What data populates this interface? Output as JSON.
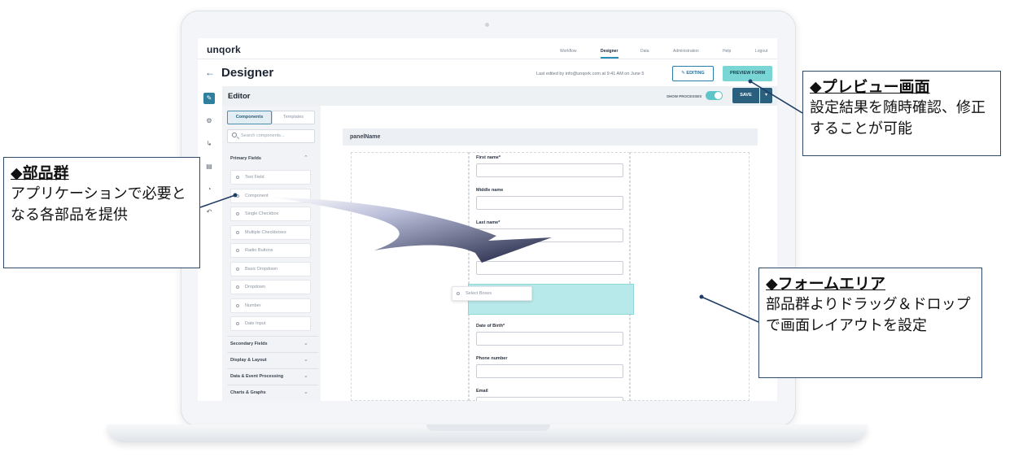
{
  "app": {
    "logo": "unqork",
    "nav": [
      "Workflow",
      "Designer",
      "Data",
      "Administration",
      "Help",
      "Logout"
    ],
    "active_nav": "Designer"
  },
  "header": {
    "back_icon": "arrow-left-icon",
    "title": "Designer",
    "last_edited": "Last edited by info@unqork.com at 9:41 AM on June 5",
    "editing_label": "EDITING",
    "preview_label": "PREVIEW FORM"
  },
  "editor": {
    "title": "Editor",
    "show_processes_label": "SHOW PROCESSES",
    "save_label": "SAVE",
    "caret": "▾"
  },
  "rail": {
    "icons": [
      "pencil-icon",
      "gear-icon",
      "workflow-icon",
      "clipboard-icon",
      "palette-icon",
      "hierarchy-icon"
    ]
  },
  "components": {
    "tab_components": "Components",
    "tab_templates": "Templates",
    "search_placeholder": "Search components...",
    "primary_header": "Primary Fields",
    "primary_items": [
      "Text Field",
      "Component",
      "Single Checkbox",
      "Multiple Checkboxes",
      "Radio Buttons",
      "Basic Dropdown",
      "Dropdown",
      "Number",
      "Date Input"
    ],
    "sections": [
      "Secondary Fields",
      "Display & Layout",
      "Data & Event Processing",
      "Charts & Graphs"
    ]
  },
  "canvas": {
    "panel_name": "panelName",
    "fields": [
      "First name*",
      "Middle name",
      "Last name*",
      "Date of Birth*",
      "Phone number",
      "Email"
    ],
    "drag_item": "Select Boxes"
  },
  "annotations": {
    "preview": {
      "title": "◆プレビュー画面",
      "body": "設定結果を随時確認、修正することが可能"
    },
    "parts": {
      "title": "◆部品群",
      "body": "アプリケーションで必要となる各部品を提供"
    },
    "form": {
      "title": "◆フォームエリア",
      "body": "部品群よりドラッグ＆ドロップで画面レイアウトを設定"
    }
  },
  "colors": {
    "accent": "#2b5f7e",
    "teal": "#7ad6d4",
    "drop_zone": "#b8e9ea",
    "callout_border": "#2e4a6a"
  }
}
